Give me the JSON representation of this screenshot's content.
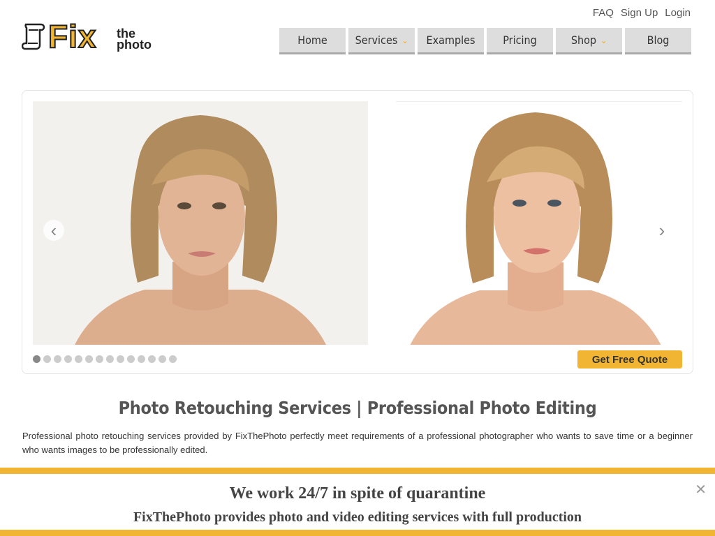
{
  "top_links": {
    "faq": "FAQ",
    "signup": "Sign Up",
    "login": "Login"
  },
  "logo": {
    "mark": "Fix",
    "the": "the",
    "photo": "photo"
  },
  "nav": {
    "home": "Home",
    "services": "Services",
    "examples": "Examples",
    "pricing": "Pricing",
    "shop": "Shop",
    "blog": "Blog",
    "dropdown_icon": "chevron-down-icon"
  },
  "slider": {
    "prev_icon": "chevron-left-icon",
    "next_icon": "chevron-right-icon",
    "slide_count": 14,
    "active_slide": 1,
    "quote_button": "Get Free Quote"
  },
  "main": {
    "title": "Photo Retouching Services | Professional Photo Editing",
    "intro": "Professional photo retouching services provided by FixThePhoto perfectly meet requirements of a professional photographer who wants to save time or a beginner who wants images to be professionally edited."
  },
  "banner": {
    "headline": "We work 24/7 in spite of quarantine",
    "subline": "FixThePhoto provides photo and video editing services with full production",
    "close_icon": "close-icon"
  },
  "colors": {
    "accent": "#f2b533",
    "nav_bg": "#dddddd"
  }
}
